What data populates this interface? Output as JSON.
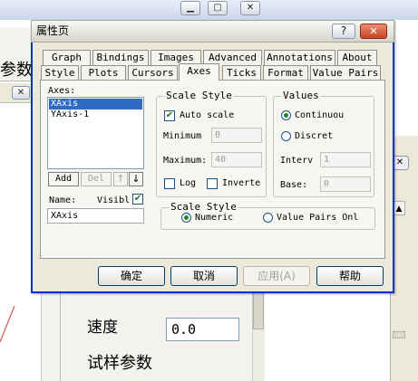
{
  "background": {
    "left_label": "参数",
    "speed_label": "速度",
    "speed_value": "0.0",
    "sample_params": "试样参数"
  },
  "dialog": {
    "title": "属性页",
    "help_glyph": "?",
    "close_glyph": "✕",
    "tabs_row1": [
      "Graph",
      "Bindings",
      "Images",
      "Advanced",
      "Annotations",
      "About"
    ],
    "tabs_row2": [
      "Style",
      "Plots",
      "Cursors",
      "Axes",
      "Ticks",
      "Format",
      "Value Pairs"
    ],
    "active_tab": "Axes",
    "axes": {
      "label": "Axes:",
      "items": [
        "XAxis",
        "YAxis-1"
      ],
      "selected": "XAxis",
      "add": "Add",
      "del": "Del",
      "name_label": "Name:",
      "name_value": "XAxis",
      "visible_label": "Visibl"
    },
    "scale_style": {
      "caption": "Scale Style",
      "auto_scale": "Auto scale",
      "minimum_label": "Minimum",
      "minimum_value": "0",
      "maximum_label": "Maximum:",
      "maximum_value": "40",
      "log": "Log",
      "inverted": "Inverte"
    },
    "values": {
      "caption": "Values",
      "continuous": "Continuou",
      "discrete": "Discret",
      "interval_label": "Interv",
      "interval_value": "1",
      "base_label": "Base:",
      "base_value": "0"
    },
    "scale_style2": {
      "caption": "Scale Style",
      "numeric": "Numeric",
      "value_pairs": "Value Pairs Onl"
    },
    "buttons": {
      "ok": "确定",
      "cancel": "取消",
      "apply": "应用(A)",
      "help": "帮助"
    }
  },
  "colors": {
    "titlebar": "#0b5bd8",
    "selection": "#316ac5",
    "dialog_face": "#ece9d8"
  }
}
